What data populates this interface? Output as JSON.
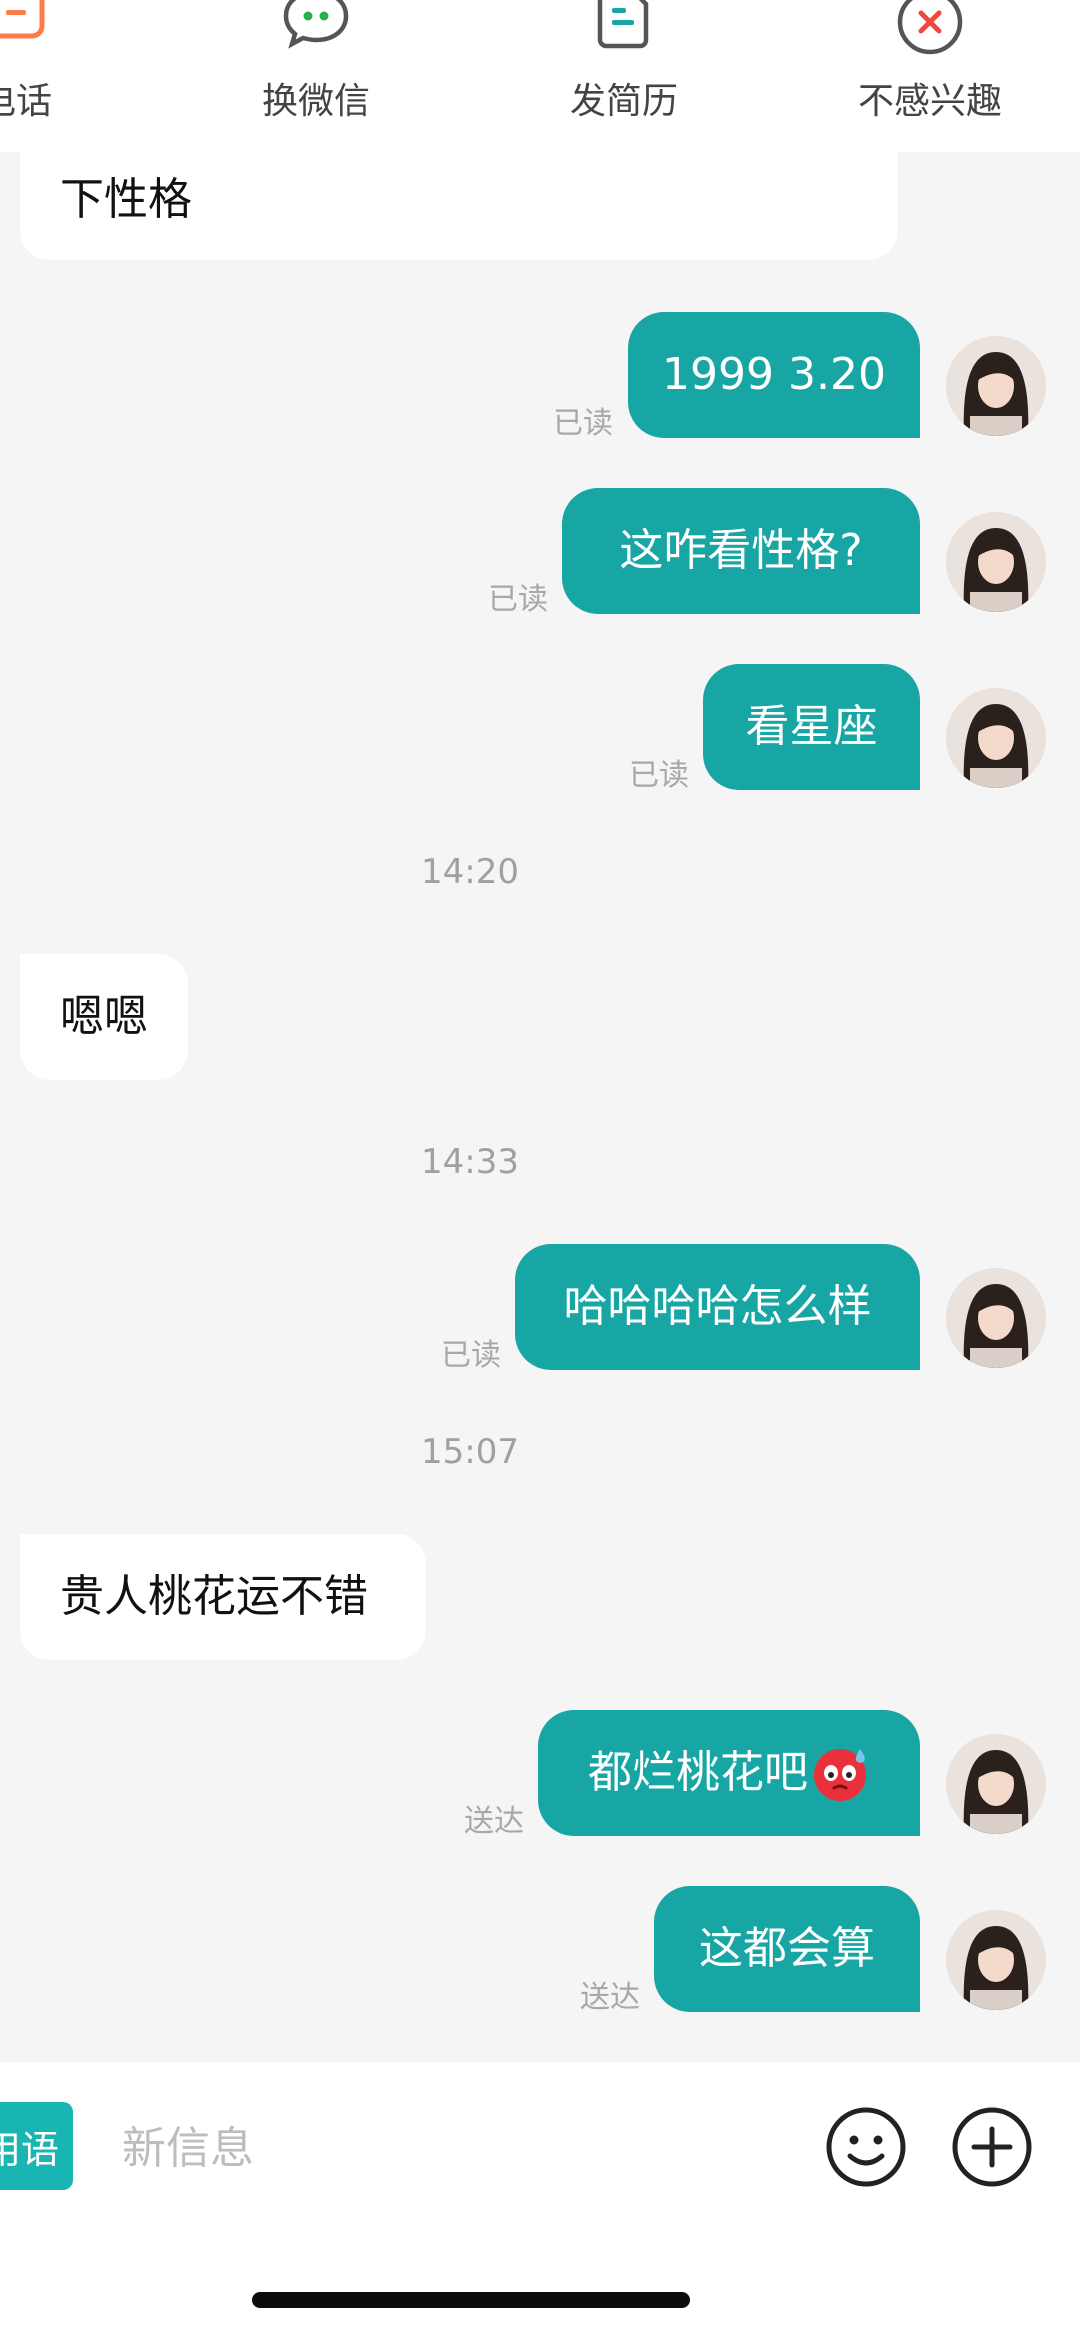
{
  "topbar": {
    "actions": [
      {
        "label": "电话",
        "icon": "phone-icon"
      },
      {
        "label": "换微信",
        "icon": "wechat-icon"
      },
      {
        "label": "发简历",
        "icon": "resume-icon"
      },
      {
        "label": "不感兴趣",
        "icon": "not-interested-icon"
      }
    ]
  },
  "chat": {
    "partial_message": "下性格",
    "messages": [
      {
        "text": "1999 3.20",
        "status": "已读"
      },
      {
        "text": "这咋看性格?",
        "status": "已读"
      },
      {
        "text": "看星座",
        "status": "已读"
      },
      {
        "text": "嗯嗯"
      },
      {
        "text": "哈哈哈哈怎么样",
        "status": "已读"
      },
      {
        "text": "贵人桃花运不错"
      },
      {
        "text": "都烂桃花吧",
        "status": "送达",
        "emoji": "cold-sweat-face-emoji"
      },
      {
        "text": "这都会算",
        "status": "送达"
      }
    ],
    "timestamps": [
      "14:20",
      "14:33",
      "15:07"
    ]
  },
  "input": {
    "phrases_label": "用语",
    "placeholder": "新信息"
  },
  "colors": {
    "accent": "#18a6a5",
    "background": "#f5f5f5",
    "incoming_bubble": "#ffffff"
  }
}
